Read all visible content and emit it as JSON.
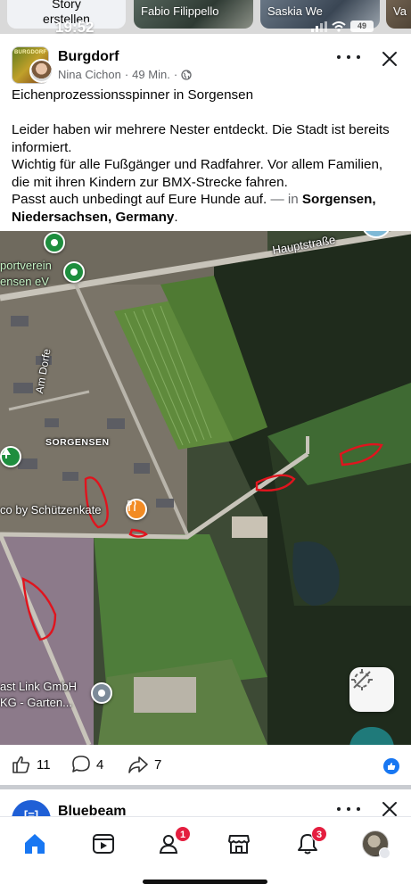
{
  "status_bar": {
    "time": "19:52",
    "battery": "49"
  },
  "stories": [
    {
      "label": "Story\nerstellen"
    },
    {
      "name": "Fabio Filippello"
    },
    {
      "name": "Saskia We"
    },
    {
      "name": "Va"
    }
  ],
  "post": {
    "group_name": "Burgdorf",
    "group_avatar_text": "BURGDORF",
    "author": "Nina Cichon",
    "time": "49 Min.",
    "separator": "·",
    "title_line": "Eichenprozessionsspinner in Sorgensen",
    "body_lines": [
      "Leider haben wir mehrere Nester entdeckt. Die Stadt ist bereits informiert.",
      "Wichtig für alle Fußgänger und Radfahrer. Vor allem Familien, die mit ihren Kindern zur BMX-Strecke fahren.",
      "Passt auch unbedingt auf Eure Hunde auf."
    ],
    "location_prefix": " — in ",
    "location": "Sorgensen, Niedersachsen, Germany",
    "location_suffix": "."
  },
  "map": {
    "labels": {
      "hauptstrasse": "Hauptstraße",
      "sportverein_1": "portverein",
      "sportverein_2": "ensen eV",
      "am_dorfe": "Am Dorfe",
      "sorgensen": "SORGENSEN",
      "schuetzenkate": "co by Schützenkate",
      "ost_link_1": "ast Link GmbH",
      "ost_link_2": "KG - Garten..."
    },
    "colors": {
      "marker_red": "#e0141e",
      "pin_green": "#1e8e3e",
      "pin_orange": "#f28b24",
      "pin_gray": "#7c8a99"
    }
  },
  "reactions": {
    "likes": "11",
    "comments": "4",
    "shares": "7"
  },
  "next_post": {
    "avatar_text": "[=]",
    "name": "Bluebeam"
  },
  "bottom_nav": {
    "friends_badge": "1",
    "notifications_badge": "3"
  },
  "colors": {
    "accent": "#1877f2",
    "badge": "#e41e3f",
    "secondary_text": "#65676b"
  }
}
